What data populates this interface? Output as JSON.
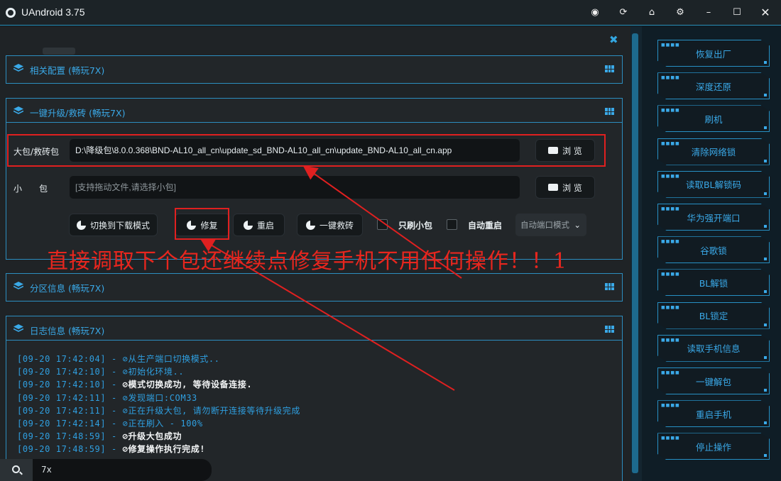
{
  "app": {
    "title": "UAndroid 3.75"
  },
  "colors": {
    "accent": "#3aa9e8",
    "annotation_red": "#e02020"
  },
  "titlebar_icons": [
    "globe-icon",
    "refresh-icon",
    "home-icon",
    "gear-icon",
    "minimize-icon",
    "maximize-icon",
    "close-icon"
  ],
  "panels": {
    "config": {
      "title": "相关配置 (畅玩7X)"
    },
    "flash": {
      "title": "一键升级/救砖 (畅玩7X)"
    },
    "partition": {
      "title": "分区信息 (畅玩7X)"
    },
    "log": {
      "title": "日志信息 (畅玩7X)"
    }
  },
  "flash_form": {
    "big_label": "大包/救砖包",
    "big_value": "D:\\降级包\\8.0.0.368\\BND-AL10_all_cn\\update_sd_BND-AL10_all_cn\\update_BND-AL10_all_cn.app",
    "small_label": "小　　包",
    "small_placeholder": "[支持拖动文件,请选择小包]",
    "browse": "浏 览",
    "btn_download_mode": "切换到下载模式",
    "btn_repair": "修复",
    "btn_reboot": "重启",
    "btn_unbrick": "一键救砖",
    "chk_small_only": "只刷小包",
    "chk_auto_reboot": "自动重启",
    "port_mode": "自动端口模式"
  },
  "annotation": "直接调取下个包还继续点修复手机不用任何操作！！1",
  "log_lines": [
    {
      "ts": "[09-20 17:42:04] - ",
      "msg": "从生产端口切换模式..",
      "bold": false
    },
    {
      "ts": "[09-20 17:42:10] - ",
      "msg": "初始化环境..",
      "bold": false
    },
    {
      "ts": "[09-20 17:42:10] - ",
      "msg": "模式切换成功, 等待设备连接.",
      "bold": true
    },
    {
      "ts": "[09-20 17:42:11] - ",
      "msg": "发现端口:COM33",
      "bold": false
    },
    {
      "ts": "[09-20 17:42:11] - ",
      "msg": "正在升级大包, 请勿断开连接等待升级完成",
      "bold": false
    },
    {
      "ts": "[09-20 17:42:14] - ",
      "msg": "正在刷入 - 100%",
      "bold": false
    },
    {
      "ts": "[09-20 17:48:59] - ",
      "msg": "升级大包成功",
      "bold": true
    },
    {
      "ts": "[09-20 17:48:59] - ",
      "msg": "修复操作执行完成!",
      "bold": true
    }
  ],
  "search": {
    "value": "7x"
  },
  "sidebar": {
    "items": [
      "恢复出厂",
      "深度还原",
      "刷机",
      "清除网络锁",
      "读取BL解锁码",
      "华为强开端口",
      "谷歌锁",
      "BL解锁",
      "BL锁定",
      "读取手机信息",
      "一键解包",
      "重启手机",
      "停止操作"
    ]
  }
}
